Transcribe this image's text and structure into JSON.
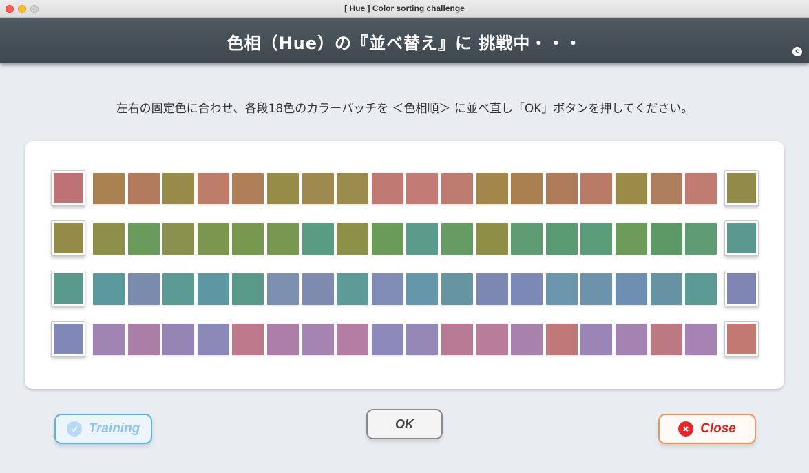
{
  "window": {
    "title": "[ Hue ] Color sorting challenge"
  },
  "banner": {
    "title": "色相（Hue）の『並べ替え』に 挑戦中・・・",
    "copyright_symbol": "c"
  },
  "instruction": "左右の固定色に合わせ、各段18色のカラーパッチを ＜色相順＞ に並べ直し「OK」ボタンを押してください。",
  "rows": [
    {
      "left_fixed": "#bd7275",
      "right_fixed": "#928a48",
      "patches": [
        "#aa8150",
        "#b47a5d",
        "#988a48",
        "#bd7b6a",
        "#b07f58",
        "#968c47",
        "#9e8a4f",
        "#9a8c4c",
        "#c07a73",
        "#c27c75",
        "#bd7b70",
        "#a38649",
        "#ab8051",
        "#b07b5b",
        "#ba7b66",
        "#9b8b48",
        "#ad7f5e",
        "#c07c70"
      ]
    },
    {
      "left_fixed": "#958b48",
      "right_fixed": "#5a9890",
      "patches": [
        "#8d8f4b",
        "#6a9b5c",
        "#8a914f",
        "#7c9650",
        "#78984e",
        "#789750",
        "#5a9b84",
        "#8d9049",
        "#6b9b58",
        "#5c9b8c",
        "#669b63",
        "#8f8e46",
        "#5e9b72",
        "#5b9b74",
        "#5a9b79",
        "#6c9b5a",
        "#5c9966",
        "#5f9b72"
      ]
    },
    {
      "left_fixed": "#5a9a8c",
      "right_fixed": "#8086b4",
      "patches": [
        "#5c999c",
        "#7a8cae",
        "#5c9b93",
        "#5e96a2",
        "#5a9a8a",
        "#7a90ae",
        "#7e8aae",
        "#5e9b97",
        "#808cb3",
        "#6696a9",
        "#6694a0",
        "#7d88b2",
        "#7c88b5",
        "#6c96ac",
        "#6c92ac",
        "#6e8fb2",
        "#6792a4",
        "#5c9b93"
      ]
    },
    {
      "left_fixed": "#7f88b6",
      "right_fixed": "#c07870",
      "patches": [
        "#a084b2",
        "#ab7ea6",
        "#9485b4",
        "#8b89b7",
        "#bc7a8c",
        "#ad7ea8",
        "#a485b2",
        "#b47ea4",
        "#8d89b8",
        "#9489b6",
        "#b87a94",
        "#b77d99",
        "#a881ac",
        "#c07879",
        "#9a85b6",
        "#a384b0",
        "#bc7983",
        "#a683b2"
      ]
    }
  ],
  "buttons": {
    "training": "Training",
    "ok": "OK",
    "close": "Close"
  }
}
